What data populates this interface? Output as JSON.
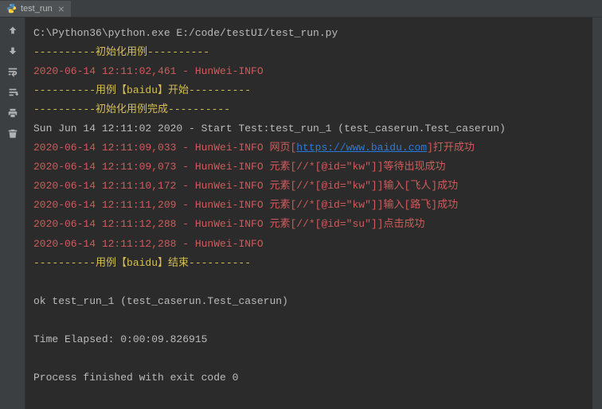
{
  "tab": {
    "label": "test_run"
  },
  "console": {
    "cmd": "C:\\Python36\\python.exe E:/code/testUI/test_run.py",
    "sep1": "----------初始化用例----------",
    "log1": "2020-06-14 12:11:02,461 - HunWei-INFO",
    "sep2": "----------用例【baidu】开始----------",
    "sep3": "----------初始化用例完成----------",
    "start": "Sun Jun 14 12:11:02 2020 - Start Test:test_run_1 (test_caserun.Test_caserun)",
    "log2_a": "2020-06-14 12:11:09,033 - HunWei-INFO 网页[",
    "log2_link": "https://www.baidu.com",
    "log2_b": "]打开成功",
    "log3": "2020-06-14 12:11:09,073 - HunWei-INFO 元素[//*[@id=\"kw\"]]等待出现成功",
    "log4": "2020-06-14 12:11:10,172 - HunWei-INFO 元素[//*[@id=\"kw\"]]输入[飞人]成功",
    "log5": "2020-06-14 12:11:11,209 - HunWei-INFO 元素[//*[@id=\"kw\"]]输入[路飞]成功",
    "log6": "2020-06-14 12:11:12,288 - HunWei-INFO 元素[//*[@id=\"su\"]]点击成功",
    "log7": "2020-06-14 12:11:12,288 - HunWei-INFO",
    "sep4": "----------用例【baidu】结束----------",
    "ok": "ok test_run_1 (test_caserun.Test_caserun)",
    "elapsed": "Time Elapsed: 0:00:09.826915",
    "exit": "Process finished with exit code 0"
  }
}
